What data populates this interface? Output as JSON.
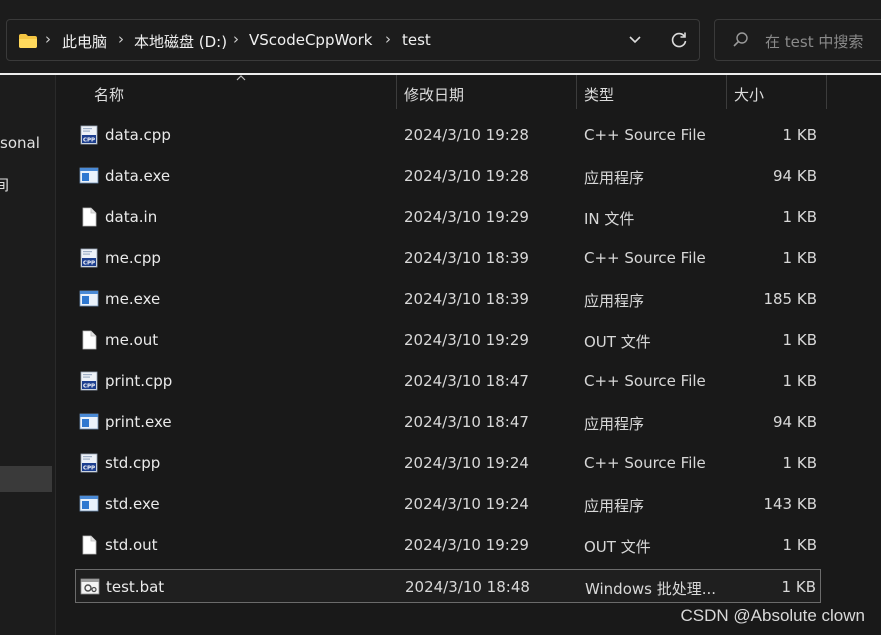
{
  "breadcrumb": {
    "items": [
      "此电脑",
      "本地磁盘 (D:)",
      "VScodeCppWork",
      "test"
    ]
  },
  "search": {
    "placeholder": "在 test 中搜索"
  },
  "nav": {
    "item1": "sonal",
    "item2": "间"
  },
  "columns": {
    "name": "名称",
    "date": "修改日期",
    "type": "类型",
    "size": "大小"
  },
  "files": [
    {
      "name": "data.cpp",
      "date": "2024/3/10 19:28",
      "type": "C++ Source File",
      "size": "1 KB",
      "icon": "cpp-file-icon"
    },
    {
      "name": "data.exe",
      "date": "2024/3/10 19:28",
      "type": "应用程序",
      "size": "94 KB",
      "icon": "exe-file-icon"
    },
    {
      "name": "data.in",
      "date": "2024/3/10 19:29",
      "type": "IN 文件",
      "size": "1 KB",
      "icon": "blank-file-icon"
    },
    {
      "name": "me.cpp",
      "date": "2024/3/10 18:39",
      "type": "C++ Source File",
      "size": "1 KB",
      "icon": "cpp-file-icon"
    },
    {
      "name": "me.exe",
      "date": "2024/3/10 18:39",
      "type": "应用程序",
      "size": "185 KB",
      "icon": "exe-file-icon"
    },
    {
      "name": "me.out",
      "date": "2024/3/10 19:29",
      "type": "OUT 文件",
      "size": "1 KB",
      "icon": "blank-file-icon"
    },
    {
      "name": "print.cpp",
      "date": "2024/3/10 18:47",
      "type": "C++ Source File",
      "size": "1 KB",
      "icon": "cpp-file-icon"
    },
    {
      "name": "print.exe",
      "date": "2024/3/10 18:47",
      "type": "应用程序",
      "size": "94 KB",
      "icon": "exe-file-icon"
    },
    {
      "name": "std.cpp",
      "date": "2024/3/10 19:24",
      "type": "C++ Source File",
      "size": "1 KB",
      "icon": "cpp-file-icon"
    },
    {
      "name": "std.exe",
      "date": "2024/3/10 19:24",
      "type": "应用程序",
      "size": "143 KB",
      "icon": "exe-file-icon"
    },
    {
      "name": "std.out",
      "date": "2024/3/10 19:29",
      "type": "OUT 文件",
      "size": "1 KB",
      "icon": "blank-file-icon"
    },
    {
      "name": "test.bat",
      "date": "2024/3/10 18:48",
      "type": "Windows 批处理...",
      "size": "1 KB",
      "icon": "bat-file-icon",
      "selected": true
    }
  ],
  "watermark": "CSDN @Absolute clown"
}
